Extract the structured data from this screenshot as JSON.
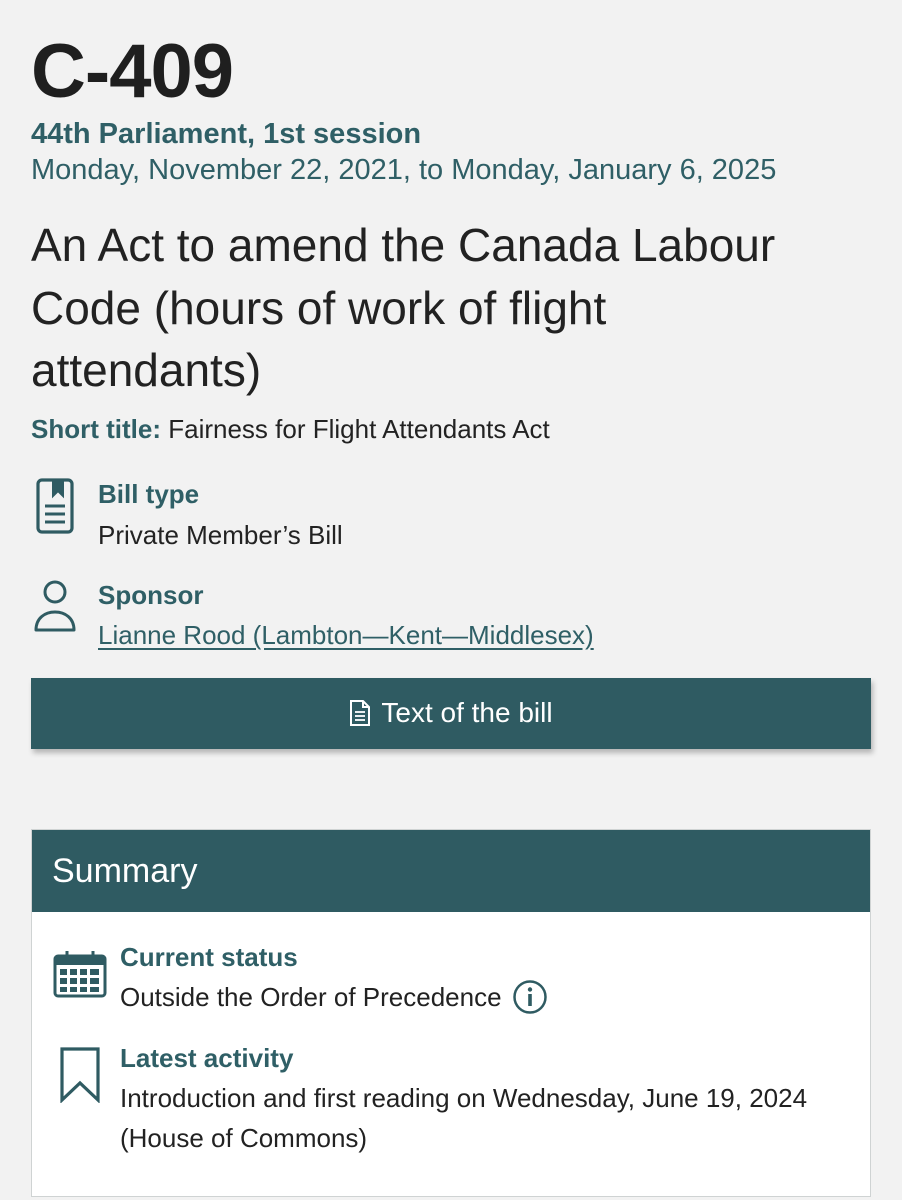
{
  "bill": {
    "number": "C-409",
    "parliament": "44th Parliament, 1st session",
    "date_range": "Monday, November 22, 2021, to Monday, January 6, 2025",
    "title": "An Act to amend the Canada Labour Code (hours of work of flight attendants)",
    "short_title_label": "Short title:",
    "short_title": "Fairness for Flight Attendants Act"
  },
  "bill_type": {
    "label": "Bill type",
    "value": "Private Member’s Bill",
    "icon": "document-bookmark-icon"
  },
  "sponsor": {
    "label": "Sponsor",
    "value": "Lianne Rood (Lambton—Kent—Middlesex)",
    "icon": "person-icon"
  },
  "text_button": {
    "label": "Text of the bill",
    "icon": "document-icon"
  },
  "summary": {
    "title": "Summary",
    "current_status": {
      "label": "Current status",
      "value": "Outside the Order of Precedence",
      "icon": "calendar-icon",
      "info_icon": "info-circle-icon"
    },
    "latest_activity": {
      "label": "Latest activity",
      "value": "Introduction and first reading on Wednesday, June 19, 2024 (House of Commons)",
      "icon": "bookmark-icon"
    }
  },
  "colors": {
    "accent": "#2f5b62",
    "accent_text": "#2f5f66",
    "page_background": "#f2f2f2"
  }
}
